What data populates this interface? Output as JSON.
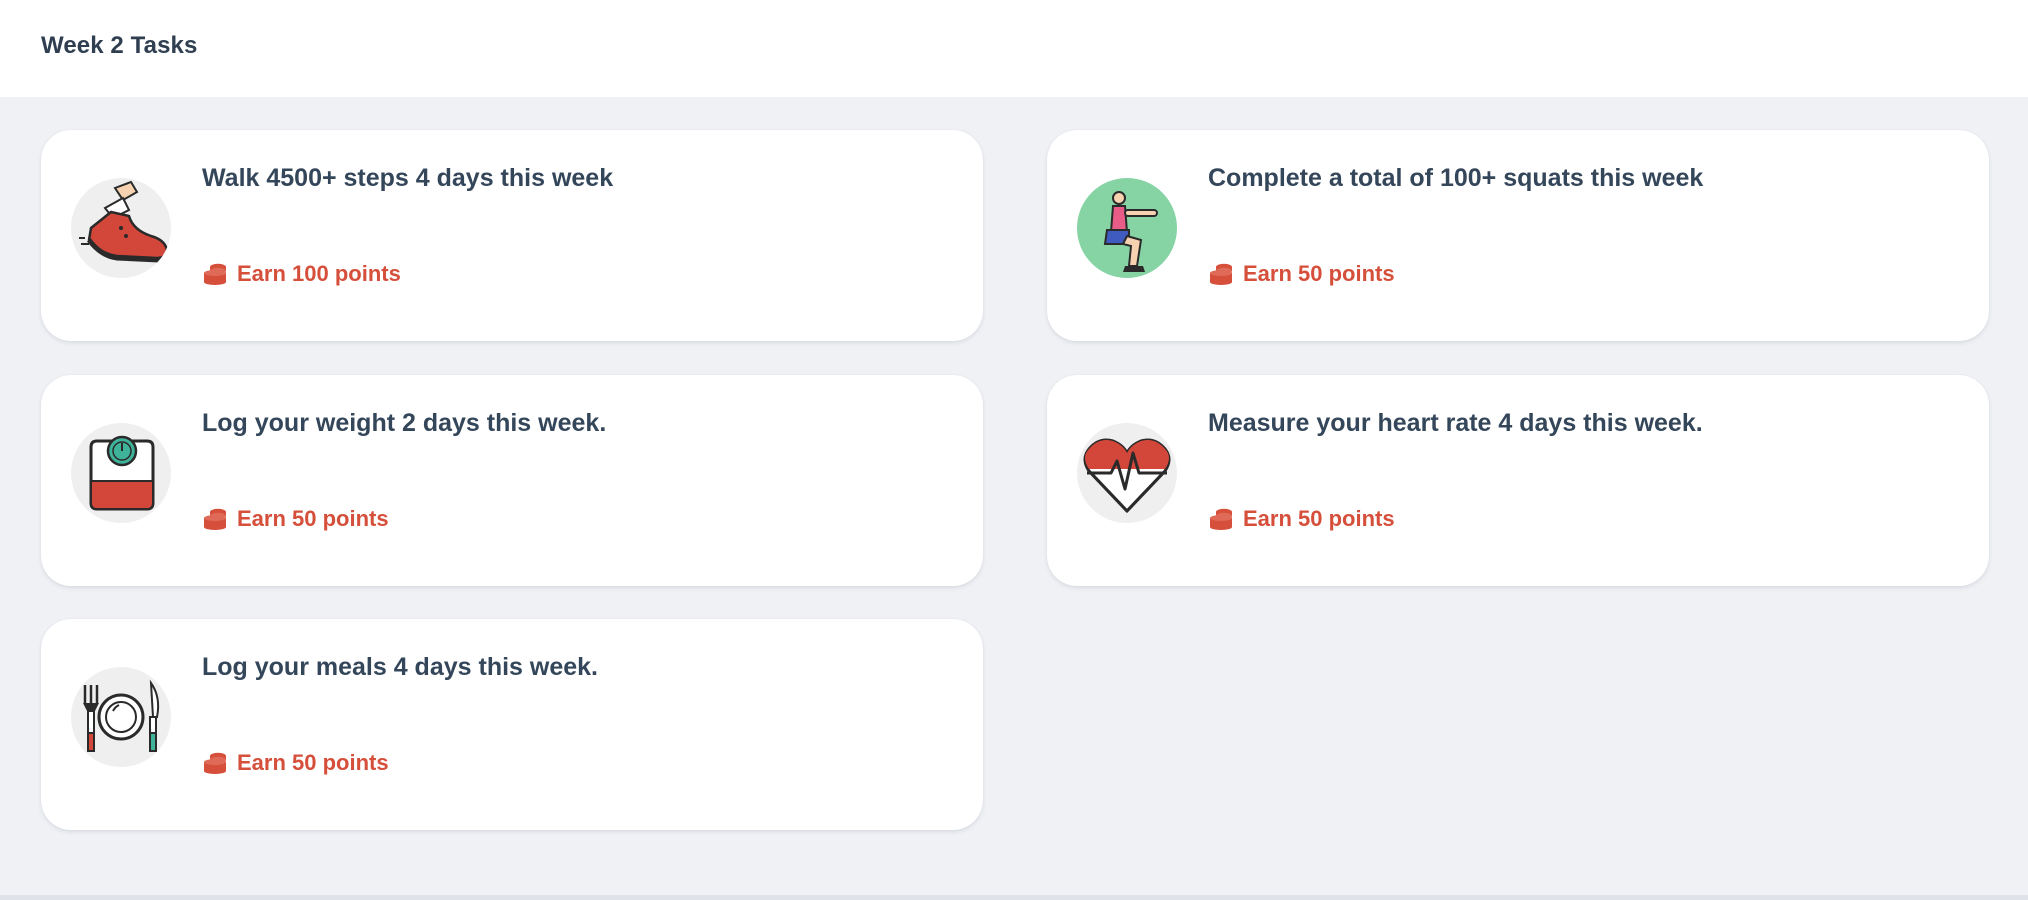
{
  "header": {
    "title": "Week 2 Tasks"
  },
  "tasks": [
    {
      "title": "Walk 4500+ steps 4 days this week",
      "points": "Earn 100 points",
      "icon": "sneaker-icon"
    },
    {
      "title": "Complete a total of 100+ squats this week",
      "points": "Earn 50 points",
      "icon": "squat-icon"
    },
    {
      "title": "Log your weight 2 days this week.",
      "points": "Earn 50 points",
      "icon": "weight-scale-icon"
    },
    {
      "title": "Measure your heart rate 4 days this week.",
      "points": "Earn 50 points",
      "icon": "heart-rate-icon"
    },
    {
      "title": "Log your meals 4 days this week.",
      "points": "Earn 50 points",
      "icon": "meal-icon"
    }
  ],
  "colors": {
    "title_text": "#34465a",
    "points_text": "#d54f3b",
    "background": "#eff1f5",
    "card": "#ffffff"
  }
}
